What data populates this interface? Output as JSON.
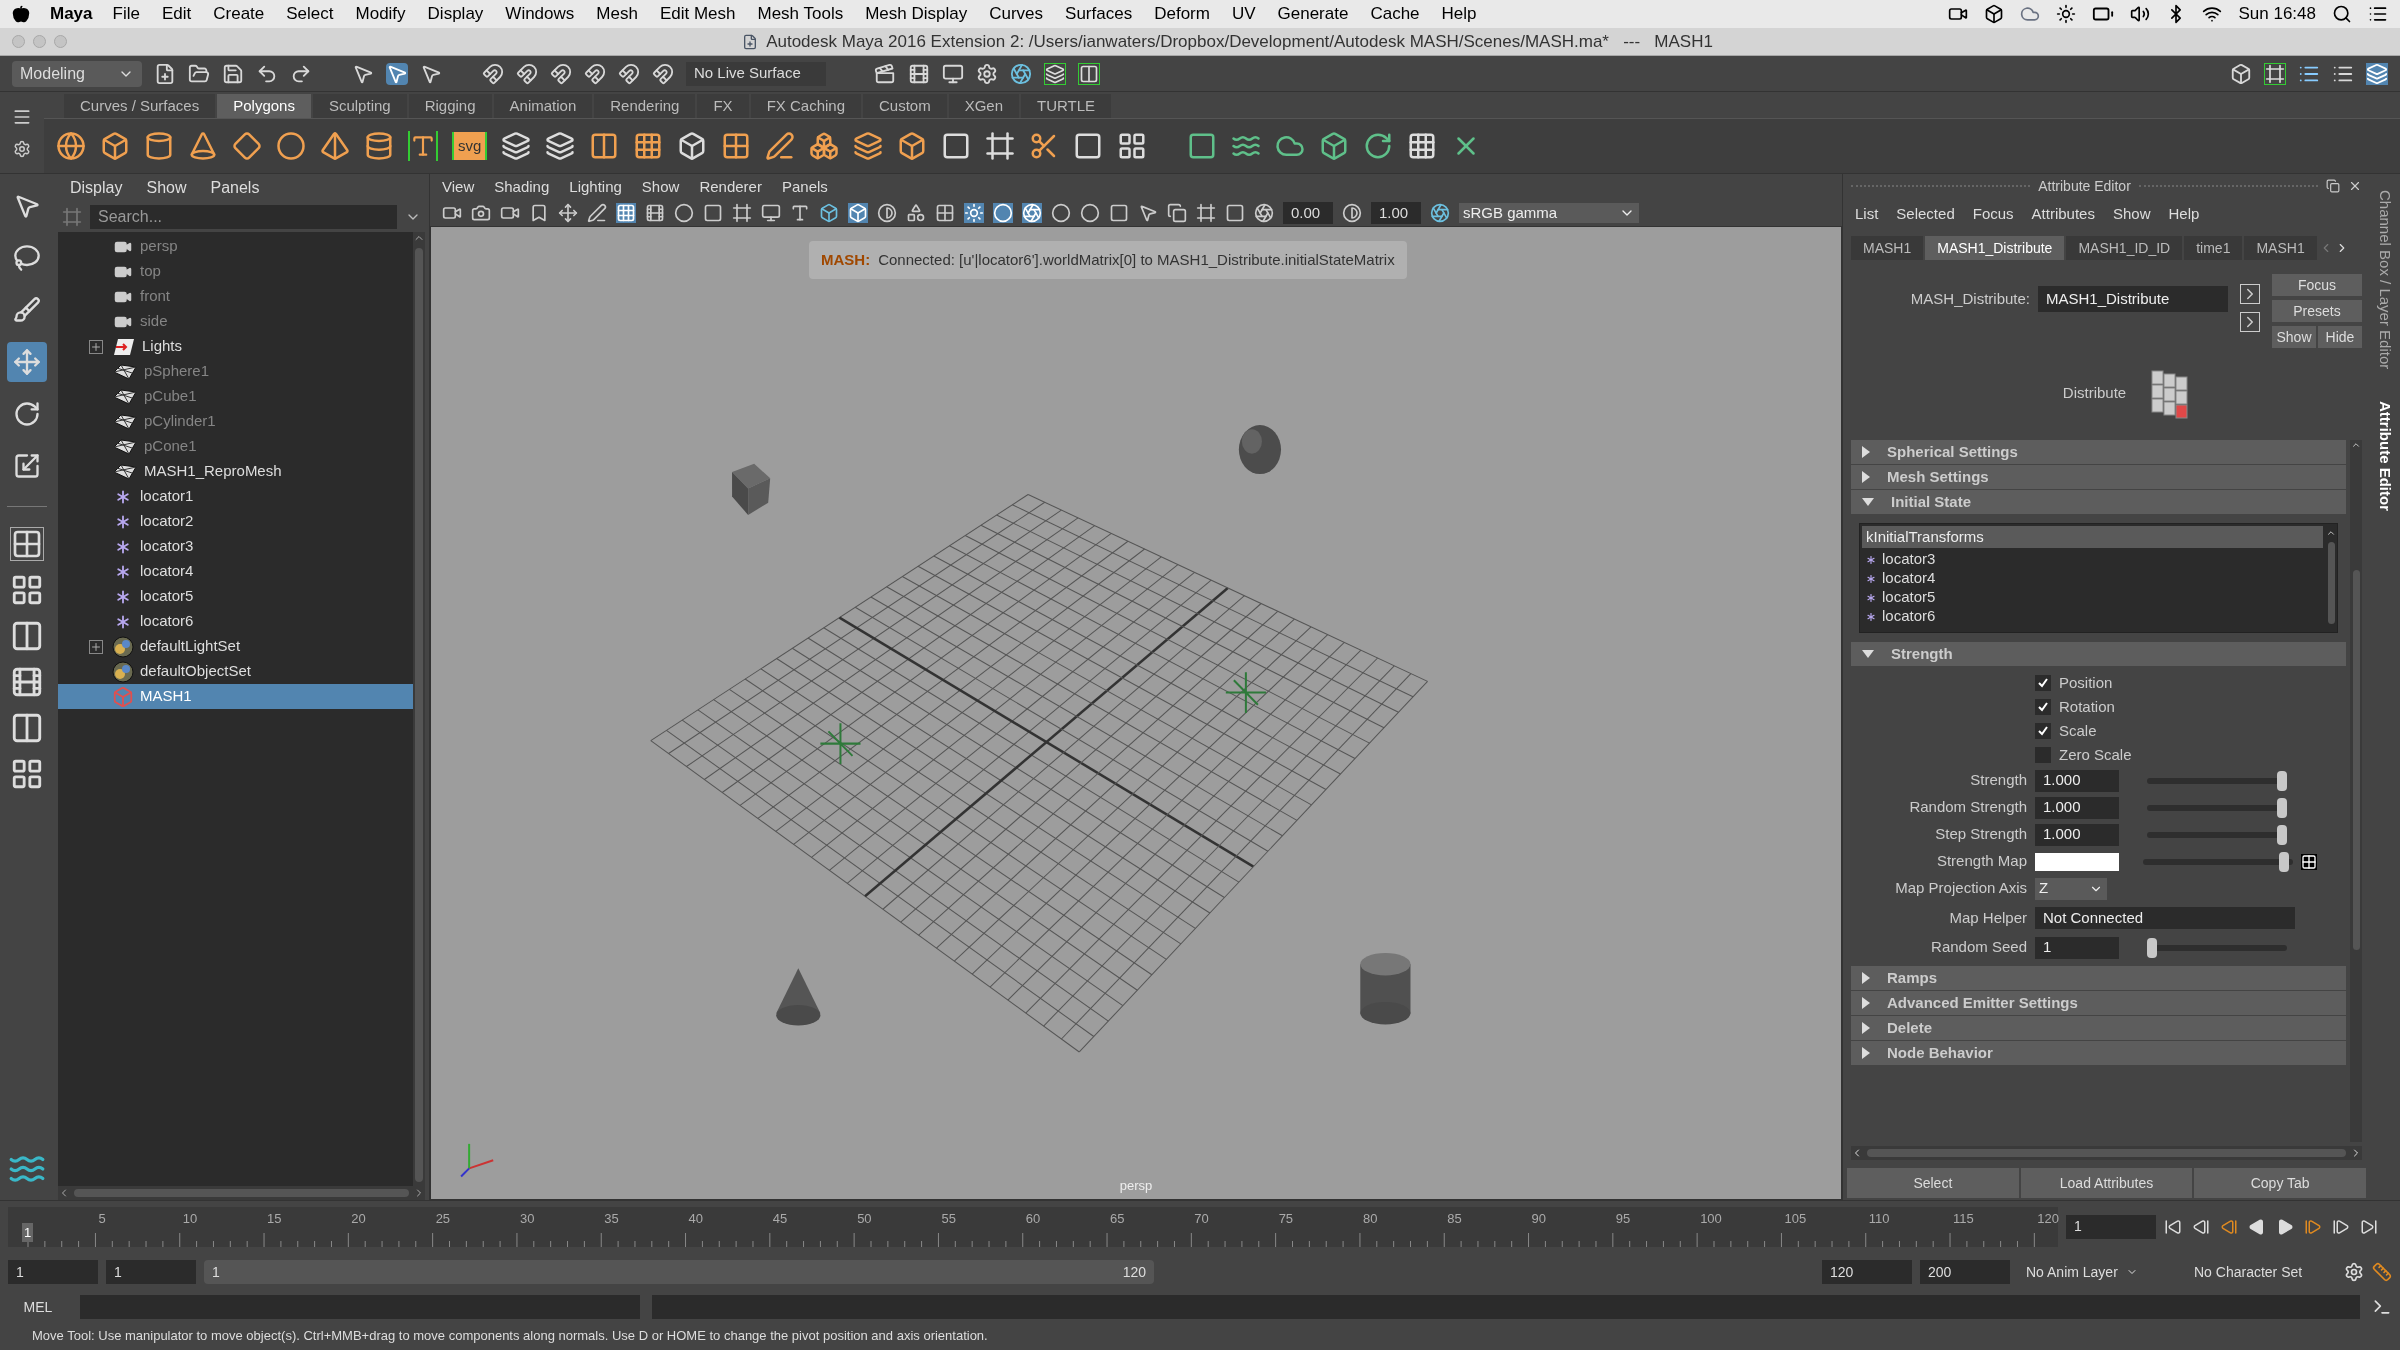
{
  "menubar": {
    "app": "Maya",
    "menus": [
      "File",
      "Edit",
      "Create",
      "Select",
      "Modify",
      "Display",
      "Windows",
      "Mesh",
      "Edit Mesh",
      "Mesh Tools",
      "Mesh Display",
      "Curves",
      "Surfaces",
      "Deform",
      "UV",
      "Generate",
      "Cache",
      "Help"
    ],
    "clock": "Sun 16:48"
  },
  "window": {
    "title": "Autodesk Maya 2016 Extension 2: /Users/ianwaters/Dropbox/Development/Autodesk MASH/Scenes/MASH.ma*   ---   MASH1"
  },
  "status_line": {
    "mode": "Modeling",
    "live_surface": "No Live Surface"
  },
  "shelf": {
    "tabs": [
      {
        "label": "Curves / Surfaces",
        "selected": false
      },
      {
        "label": "Polygons",
        "selected": true
      },
      {
        "label": "Sculpting",
        "selected": false
      },
      {
        "label": "Rigging",
        "selected": false
      },
      {
        "label": "Animation",
        "selected": false
      },
      {
        "label": "Rendering",
        "selected": false
      },
      {
        "label": "FX",
        "selected": false
      },
      {
        "label": "FX Caching",
        "selected": false
      },
      {
        "label": "Custom",
        "selected": false
      },
      {
        "label": "XGen",
        "selected": false
      },
      {
        "label": "TURTLE",
        "selected": false
      }
    ],
    "svg_label": "svg"
  },
  "toolbox": [
    {
      "kind": "select",
      "selected": false
    },
    {
      "kind": "lasso",
      "selected": false
    },
    {
      "kind": "paint",
      "selected": false
    },
    {
      "kind": "move",
      "selected": true
    },
    {
      "kind": "rotate",
      "selected": false
    },
    {
      "kind": "scale",
      "selected": false
    }
  ],
  "outliner": {
    "menus": [
      "Display",
      "Show",
      "Panels"
    ],
    "search_placeholder": "Search...",
    "items": [
      {
        "label": "persp",
        "kind": "camera",
        "dimmed": true,
        "collapsed": false,
        "selected": false
      },
      {
        "label": "top",
        "kind": "camera",
        "dimmed": true,
        "collapsed": false,
        "selected": false
      },
      {
        "label": "front",
        "kind": "camera",
        "dimmed": true,
        "collapsed": false,
        "selected": false
      },
      {
        "label": "side",
        "kind": "camera",
        "dimmed": true,
        "collapsed": false,
        "selected": false
      },
      {
        "label": "Lights",
        "kind": "light",
        "dimmed": false,
        "collapsed": true,
        "selected": false
      },
      {
        "label": "pSphere1",
        "kind": "mesh",
        "dimmed": true,
        "collapsed": false,
        "selected": false
      },
      {
        "label": "pCube1",
        "kind": "mesh",
        "dimmed": true,
        "collapsed": false,
        "selected": false
      },
      {
        "label": "pCylinder1",
        "kind": "mesh",
        "dimmed": true,
        "collapsed": false,
        "selected": false
      },
      {
        "label": "pCone1",
        "kind": "mesh",
        "dimmed": true,
        "collapsed": false,
        "selected": false
      },
      {
        "label": "MASH1_ReproMesh",
        "kind": "mesh",
        "dimmed": false,
        "collapsed": false,
        "selected": false
      },
      {
        "label": "locator1",
        "kind": "locator",
        "dimmed": false,
        "collapsed": false,
        "selected": false
      },
      {
        "label": "locator2",
        "kind": "locator",
        "dimmed": false,
        "collapsed": false,
        "selected": false
      },
      {
        "label": "locator3",
        "kind": "locator",
        "dimmed": false,
        "collapsed": false,
        "selected": false
      },
      {
        "label": "locator4",
        "kind": "locator",
        "dimmed": false,
        "collapsed": false,
        "selected": false
      },
      {
        "label": "locator5",
        "kind": "locator",
        "dimmed": false,
        "collapsed": false,
        "selected": false
      },
      {
        "label": "locator6",
        "kind": "locator",
        "dimmed": false,
        "collapsed": false,
        "selected": false
      },
      {
        "label": "defaultLightSet",
        "kind": "set",
        "dimmed": false,
        "collapsed": true,
        "selected": false
      },
      {
        "label": "defaultObjectSet",
        "kind": "set",
        "dimmed": false,
        "collapsed": false,
        "selected": false
      },
      {
        "label": "MASH1",
        "kind": "mash",
        "dimmed": false,
        "collapsed": false,
        "selected": true
      }
    ]
  },
  "viewport": {
    "menus": [
      "View",
      "Shading",
      "Lighting",
      "Show",
      "Renderer",
      "Panels"
    ],
    "exposure": "0.00",
    "gamma": "1.00",
    "color_space": "sRGB gamma",
    "message": {
      "prefix": "MASH:",
      "text": "Connected: [u'|locator6'].worldMatrix[0] to MASH1_Distribute.initialStateMatrix"
    },
    "camera_label": "persp"
  },
  "attribute_editor": {
    "title": "Attribute Editor",
    "menus": [
      "List",
      "Selected",
      "Focus",
      "Attributes",
      "Show",
      "Help"
    ],
    "tabs": [
      {
        "label": "MASH1",
        "selected": false
      },
      {
        "label": "MASH1_Distribute",
        "selected": true
      },
      {
        "label": "MASH1_ID_ID",
        "selected": false
      },
      {
        "label": "time1",
        "selected": false
      },
      {
        "label": "MASH1",
        "selected": false
      }
    ],
    "node_label": "MASH_Distribute:",
    "node_name": "MASH1_Distribute",
    "buttons": [
      "Focus",
      "Presets",
      "Show",
      "Hide"
    ],
    "node_type": "Distribute",
    "sections": [
      {
        "title": "Spherical Settings",
        "expanded": false
      },
      {
        "title": "Mesh Settings",
        "expanded": false
      },
      {
        "title": "Initial State",
        "expanded": true,
        "header": "kInitialTransforms",
        "items": [
          "locator3",
          "locator4",
          "locator5",
          "locator6"
        ]
      },
      {
        "title": "Strength",
        "expanded": true,
        "checkboxes": [
          {
            "label": "Position",
            "checked": true
          },
          {
            "label": "Rotation",
            "checked": true
          },
          {
            "label": "Scale",
            "checked": true
          },
          {
            "label": "Zero Scale",
            "checked": false
          }
        ],
        "fields": [
          {
            "kind": "slider",
            "label": "Strength",
            "value": "1.000",
            "level": 1
          },
          {
            "kind": "slider",
            "label": "Random Strength",
            "value": "1.000",
            "level": 1
          },
          {
            "kind": "slider",
            "label": "Step Strength",
            "value": "1.000",
            "level": 1
          },
          {
            "kind": "map",
            "label": "Strength Map",
            "level": 0.97
          },
          {
            "kind": "dropdown",
            "label": "Map Projection Axis",
            "value": "Z"
          },
          {
            "kind": "text",
            "label": "Map Helper",
            "value": "Not Connected"
          },
          {
            "kind": "slider",
            "label": "Random Seed",
            "value": "1",
            "level": 0
          }
        ]
      },
      {
        "title": "Ramps",
        "expanded": false
      },
      {
        "title": "Advanced Emitter Settings",
        "expanded": false
      },
      {
        "title": "Delete",
        "expanded": false
      },
      {
        "title": "Node Behavior",
        "expanded": false
      }
    ],
    "bottom_buttons": [
      "Select",
      "Load Attributes",
      "Copy Tab"
    ],
    "side_tabs": [
      {
        "label": "Channel Box / Layer Editor",
        "selected": false
      },
      {
        "label": "Attribute Editor",
        "selected": true
      }
    ]
  },
  "timeline": {
    "start_label": "1",
    "ticks": [
      "5",
      "10",
      "15",
      "20",
      "25",
      "30",
      "35",
      "40",
      "45",
      "50",
      "55",
      "60",
      "65",
      "70",
      "75",
      "80",
      "85",
      "90",
      "95",
      "100",
      "105",
      "110",
      "115",
      "120"
    ],
    "current_frame": "1"
  },
  "range": {
    "start": "1",
    "playback_start": "1",
    "slider_start": "1",
    "slider_end": "120",
    "playback_end": "120",
    "end": "200",
    "anim_layer": "No Anim Layer",
    "character_set": "No Character Set"
  },
  "command_line": {
    "label": "MEL"
  },
  "help_line": "Move Tool: Use manipulator to move object(s). Ctrl+MMB+drag to move components along normals. Use D or HOME to change the pivot position and axis orientation."
}
